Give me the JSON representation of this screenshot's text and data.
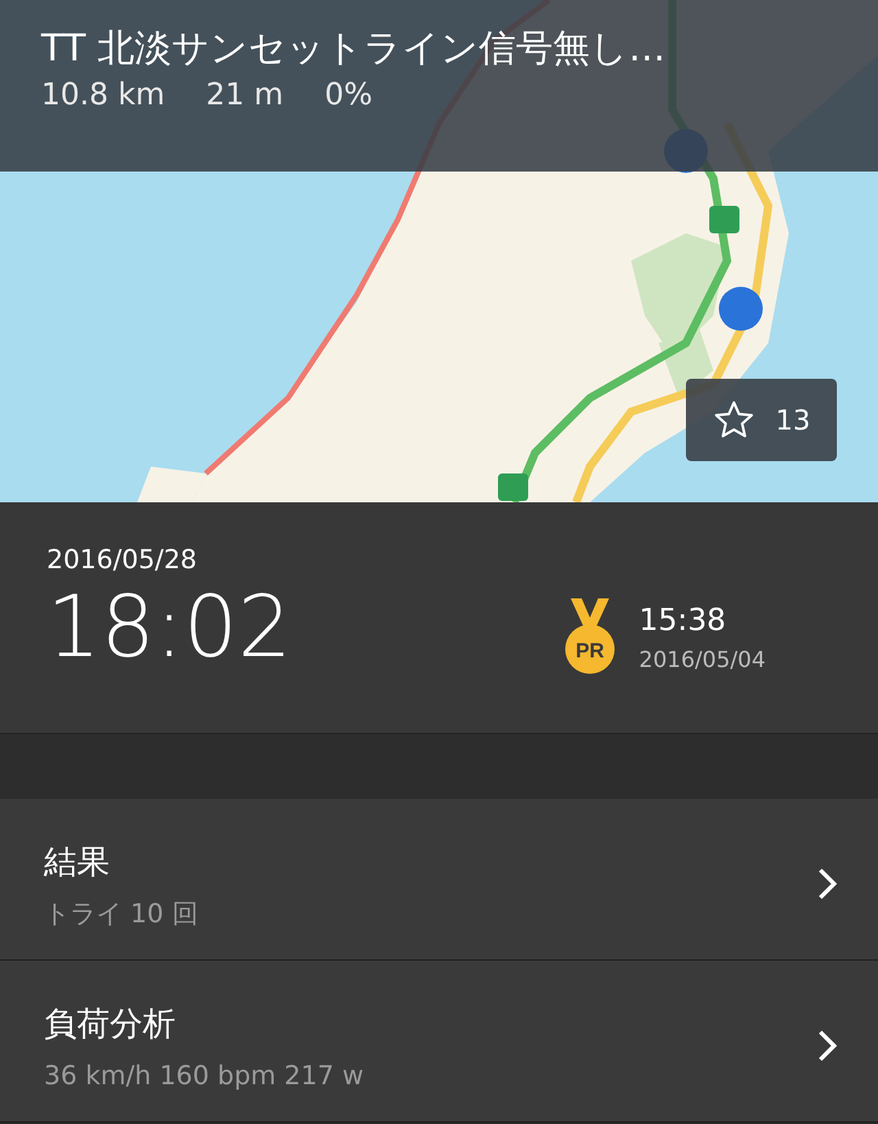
{
  "header": {
    "title": "TT 北淡サンセットライン信号無し…",
    "stats": [
      "10.8 km",
      "21 m",
      "0%"
    ]
  },
  "favorite": {
    "count": "13"
  },
  "effort": {
    "date": "2016/05/28",
    "time": "18:02",
    "pr": {
      "badge": "PR",
      "time": "15:38",
      "date": "2016/05/04"
    }
  },
  "menu": [
    {
      "title": "結果",
      "subtitle": "トライ 10 回"
    },
    {
      "title": "負荷分析",
      "subtitle": "36 km/h 160 bpm 217 w"
    }
  ]
}
